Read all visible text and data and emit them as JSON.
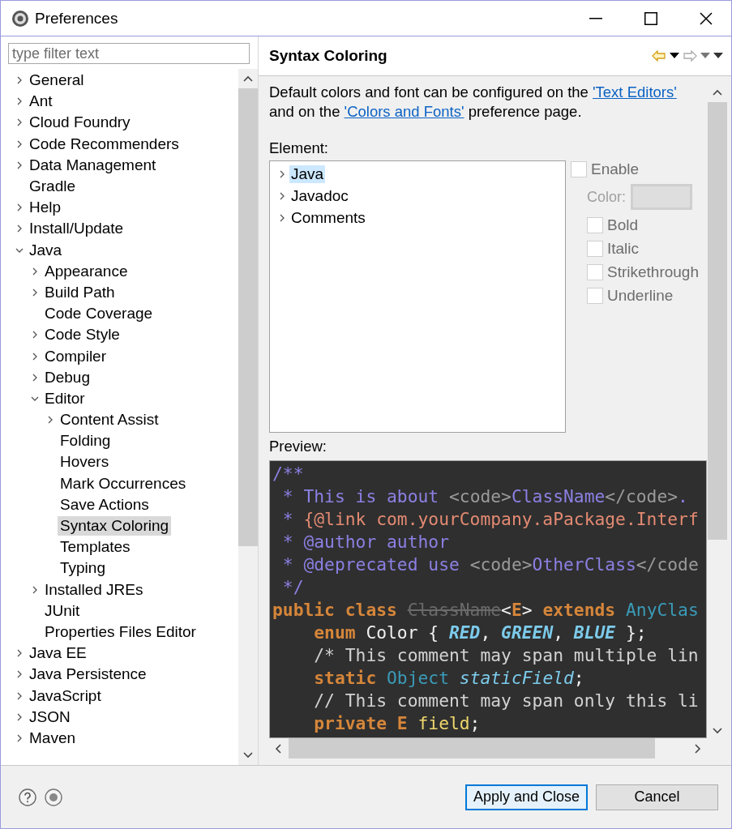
{
  "window": {
    "title": "Preferences"
  },
  "filter": {
    "placeholder": "type filter text"
  },
  "tree": [
    {
      "label": "General",
      "expanded": false,
      "selected": false
    },
    {
      "label": "Ant",
      "expanded": false,
      "selected": false
    },
    {
      "label": "Cloud Foundry",
      "expanded": false,
      "selected": false
    },
    {
      "label": "Code Recommenders",
      "expanded": false,
      "selected": false
    },
    {
      "label": "Data Management",
      "expanded": false,
      "selected": false
    },
    {
      "label": "Gradle",
      "selected": false
    },
    {
      "label": "Help",
      "expanded": false,
      "selected": false
    },
    {
      "label": "Install/Update",
      "expanded": false,
      "selected": false
    },
    {
      "label": "Java",
      "expanded": true,
      "selected": false,
      "children": [
        {
          "label": "Appearance",
          "expanded": false,
          "selected": false
        },
        {
          "label": "Build Path",
          "expanded": false,
          "selected": false
        },
        {
          "label": "Code Coverage",
          "selected": false
        },
        {
          "label": "Code Style",
          "expanded": false,
          "selected": false
        },
        {
          "label": "Compiler",
          "expanded": false,
          "selected": false
        },
        {
          "label": "Debug",
          "expanded": false,
          "selected": false
        },
        {
          "label": "Editor",
          "expanded": true,
          "selected": false,
          "children": [
            {
              "label": "Content Assist",
              "expanded": false,
              "selected": false
            },
            {
              "label": "Folding",
              "selected": false
            },
            {
              "label": "Hovers",
              "selected": false
            },
            {
              "label": "Mark Occurrences",
              "selected": false
            },
            {
              "label": "Save Actions",
              "selected": false
            },
            {
              "label": "Syntax Coloring",
              "selected": true
            },
            {
              "label": "Templates",
              "selected": false
            },
            {
              "label": "Typing",
              "selected": false
            }
          ]
        },
        {
          "label": "Installed JREs",
          "expanded": false,
          "selected": false
        },
        {
          "label": "JUnit",
          "selected": false
        },
        {
          "label": "Properties Files Editor",
          "selected": false
        }
      ]
    },
    {
      "label": "Java EE",
      "expanded": false,
      "selected": false
    },
    {
      "label": "Java Persistence",
      "expanded": false,
      "selected": false
    },
    {
      "label": "JavaScript",
      "expanded": false,
      "selected": false
    },
    {
      "label": "JSON",
      "expanded": false,
      "selected": false
    },
    {
      "label": "Maven",
      "expanded": false,
      "selected": false
    }
  ],
  "page": {
    "title": "Syntax Coloring",
    "description": [
      {
        "kind": "text",
        "text": "Default colors and font can be configured on the "
      },
      {
        "kind": "link",
        "text": "'Text Editors'"
      },
      {
        "kind": "text",
        "text": " and on the "
      },
      {
        "kind": "link",
        "text": "'Colors and Fonts'"
      },
      {
        "kind": "text",
        "text": " preference page."
      }
    ],
    "element_label": "Element:",
    "elements": [
      {
        "label": "Java",
        "expanded": false,
        "selected": true
      },
      {
        "label": "Javadoc",
        "expanded": false,
        "selected": false
      },
      {
        "label": "Comments",
        "expanded": false,
        "selected": false
      }
    ],
    "enable": {
      "label": "Enable",
      "checked": false,
      "disabled": true
    },
    "color_label": "Color:",
    "options": [
      {
        "label": "Bold",
        "checked": false,
        "disabled": true
      },
      {
        "label": "Italic",
        "checked": false,
        "disabled": true
      },
      {
        "label": "Strikethrough",
        "checked": false,
        "disabled": true
      },
      {
        "label": "Underline",
        "checked": false,
        "disabled": true
      }
    ],
    "preview_label": "Preview:",
    "preview": [
      [
        {
          "kind": "javadoc",
          "text": "/**"
        }
      ],
      [
        {
          "kind": "javadoc",
          "text": " * This is about "
        },
        {
          "kind": "html",
          "text": "<code>"
        },
        {
          "kind": "javadoc",
          "text": "ClassName"
        },
        {
          "kind": "html",
          "text": "</code>"
        },
        {
          "kind": "javadoc",
          "text": "."
        }
      ],
      [
        {
          "kind": "javadoc",
          "text": " * "
        },
        {
          "kind": "link",
          "text": "{@link com.yourCompany.aPackage.Interf"
        }
      ],
      [
        {
          "kind": "javadoc",
          "text": " * @author author"
        }
      ],
      [
        {
          "kind": "javadoc",
          "text": " * @deprecated use "
        },
        {
          "kind": "html",
          "text": "<code>"
        },
        {
          "kind": "javadoc",
          "text": "OtherClass"
        },
        {
          "kind": "html",
          "text": "</code"
        }
      ],
      [
        {
          "kind": "javadoc",
          "text": " */"
        }
      ],
      [
        {
          "kind": "keyword",
          "text": "public class "
        },
        {
          "kind": "deprecated",
          "text": "ClassName"
        },
        {
          "kind": "plain",
          "text": "<"
        },
        {
          "kind": "keyword",
          "text": "E"
        },
        {
          "kind": "plain",
          "text": "> "
        },
        {
          "kind": "keyword",
          "text": "extends "
        },
        {
          "kind": "type",
          "text": "AnyClas"
        }
      ],
      [
        {
          "kind": "indent"
        },
        {
          "kind": "keyword",
          "text": "enum "
        },
        {
          "kind": "plain",
          "text": "Color { "
        },
        {
          "kind": "enum",
          "text": "RED"
        },
        {
          "kind": "plain",
          "text": ", "
        },
        {
          "kind": "enum",
          "text": "GREEN"
        },
        {
          "kind": "plain",
          "text": ", "
        },
        {
          "kind": "enum",
          "text": "BLUE"
        },
        {
          "kind": "plain",
          "text": " };"
        }
      ],
      [
        {
          "kind": "indent"
        },
        {
          "kind": "comment",
          "text": "/* This comment may span multiple lin"
        }
      ],
      [
        {
          "kind": "indent"
        },
        {
          "kind": "keyword",
          "text": "static "
        },
        {
          "kind": "type",
          "text": "Object "
        },
        {
          "kind": "static",
          "text": "staticField"
        },
        {
          "kind": "plain",
          "text": ";"
        }
      ],
      [
        {
          "kind": "indent"
        },
        {
          "kind": "comment",
          "text": "// This comment may span only this li"
        }
      ],
      [
        {
          "kind": "indent"
        },
        {
          "kind": "keyword",
          "text": "private E "
        },
        {
          "kind": "field",
          "text": "field"
        },
        {
          "kind": "plain",
          "text": ";"
        }
      ]
    ]
  },
  "buttons": [
    {
      "label": "Apply and Close",
      "default": true
    },
    {
      "label": "Cancel",
      "default": false
    }
  ]
}
